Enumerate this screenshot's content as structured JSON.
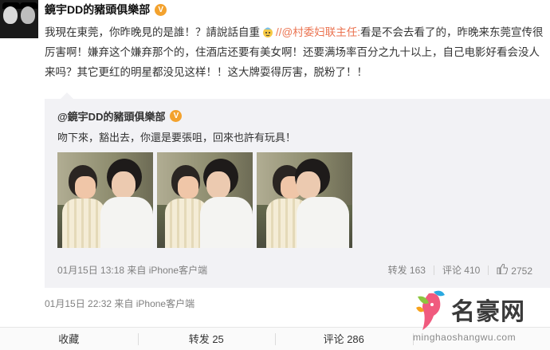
{
  "post": {
    "author": "鏡宇DD的豬頭俱樂部",
    "text_part1": "我現在東莞，你昨晚見的是誰！？請說話自重",
    "mention": "//@村委妇联主任:",
    "text_part2": "看是不会去看了的，昨晚来东莞宣传很厉害啊！嫌弃这个嫌弃那个的，住酒店还要有美女啊！还要满场率百分之九十以上，自己电影好看会没人来吗？其它更红的明星都没见这样！！这大牌耍得厉害，脱粉了！！",
    "time": "01月15日 22:32",
    "source": "来自 iPhone客户端"
  },
  "repost": {
    "author": "@鏡宇DD的豬頭俱樂部",
    "text": "吻下來，豁出去，你還是要張咀，回來也許有玩具！",
    "time": "01月15日 13:18",
    "source": "来自 iPhone客户端",
    "forward": "转发 163",
    "comment": "评论 410",
    "likes": "2752"
  },
  "bottom_bar": {
    "favorite": "收藏",
    "forward": "转发 25",
    "comment": "评论 286"
  },
  "watermark": {
    "title": "名豪网",
    "url": "minghaoshangwu.com"
  },
  "colors": {
    "mention": "#eb7350",
    "vbadge": "#f3a22e",
    "repost_bg": "#f2f2f5",
    "meta": "#808080"
  },
  "icons": {
    "verified": "v-badge-icon",
    "emoji": "face-emoji-icon",
    "like": "thumb-up-icon",
    "watermark_logo": "face-leaf-logo"
  }
}
